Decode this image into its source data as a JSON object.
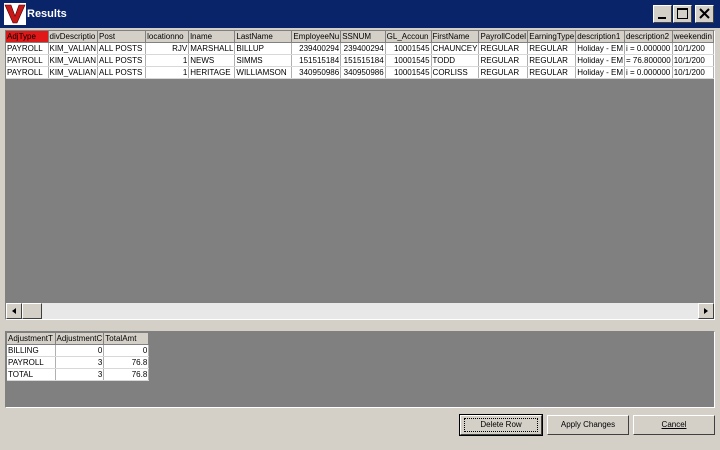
{
  "window": {
    "title": "Results"
  },
  "results_grid": {
    "columns": [
      "AdjType",
      "divDescriptio",
      "Post",
      "locationno",
      "lname",
      "LastName",
      "EmployeeNu",
      "SSNUM",
      "GL_Accoun",
      "FirstName",
      "PayrollCodeI",
      "EarningType",
      "description1",
      "description2",
      "weekendin"
    ],
    "rows": [
      [
        "PAYROLL",
        "KIM_VALIAN",
        "ALL POSTS",
        "RJV",
        "MARSHALL",
        "BILLUP",
        "239400294",
        "239400294",
        "10001545",
        "CHAUNCEY",
        "REGULAR",
        "REGULAR",
        "Holiday - EM",
        "i = 0.000000",
        "10/1/200"
      ],
      [
        "PAYROLL",
        "KIM_VALIAN",
        "ALL POSTS",
        "1",
        "NEWS",
        "SIMMS",
        "151515184",
        "151515184",
        "10001545",
        "TODD",
        "REGULAR",
        "REGULAR",
        "Holiday - EM",
        "= 76.800000",
        "10/1/200"
      ],
      [
        "PAYROLL",
        "KIM_VALIAN",
        "ALL POSTS",
        "1",
        "HERITAGE",
        "WILLIAMSON",
        "340950986",
        "340950986",
        "10001545",
        "CORLISS",
        "REGULAR",
        "REGULAR",
        "Holiday - EM",
        "i = 0.000000",
        "10/1/200"
      ]
    ]
  },
  "summary_grid": {
    "columns": [
      "AdjustmentT",
      "AdjustmentC",
      "TotalAmt"
    ],
    "rows": [
      [
        "BILLING",
        "0",
        "0"
      ],
      [
        "PAYROLL",
        "3",
        "76.8"
      ],
      [
        "TOTAL",
        "3",
        "76.8"
      ]
    ]
  },
  "buttons": {
    "delete_row": "Delete Row",
    "apply_changes": "Apply Changes",
    "cancel": "Cancel"
  }
}
